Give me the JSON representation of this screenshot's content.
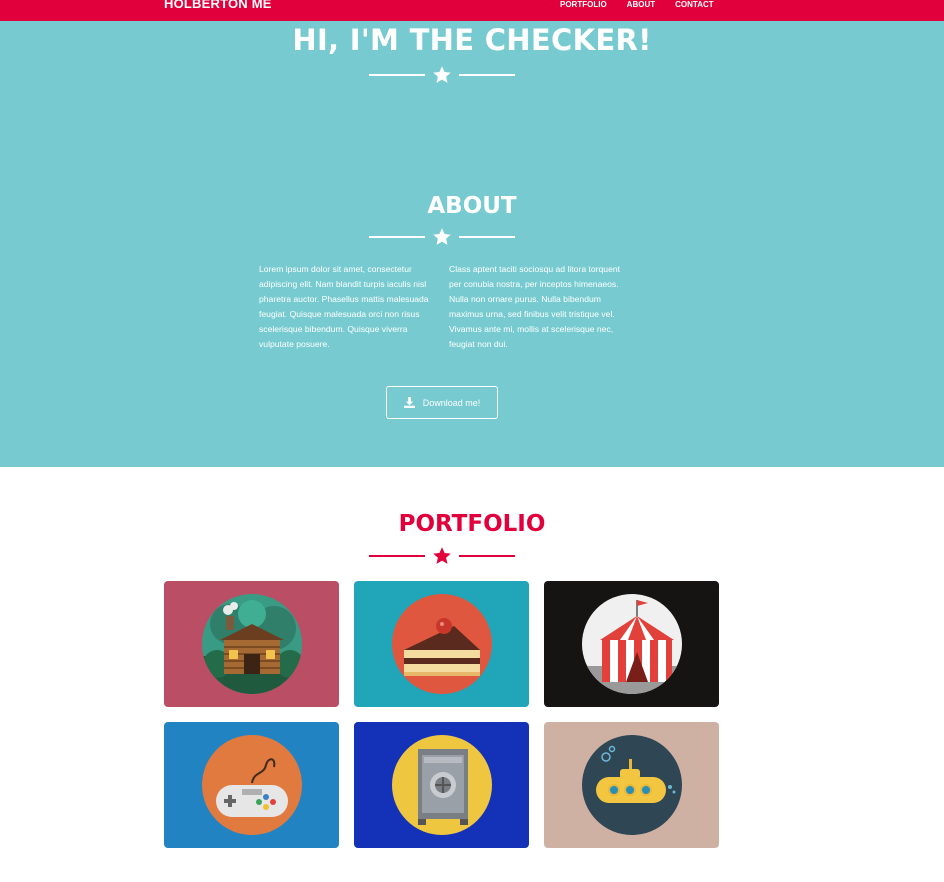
{
  "navbar": {
    "brand": "HOLBERTON ME",
    "links": [
      "PORTFOLIO",
      "ABOUT",
      "CONTACT"
    ],
    "background": "#e2003c"
  },
  "hero": {
    "title": "HI, I'M THE CHECKER!",
    "background": "#77cbd0"
  },
  "about": {
    "title": "ABOUT",
    "left_text": "Lorem ipsum dolor sit amet, consectetur adipiscing elit. Nam blandit turpis iaculis nisl pharetra auctor. Phasellus mattis malesuada feugiat. Quisque malesuada orci non risus scelerisque bibendum. Quisque viverra vulputate posuere.",
    "right_text": "Class aptent taciti sociosqu ad litora torquent per conubia nostra, per inceptos himenaeos. Nulla non ornare purus. Nulla bibendum maximus urna, sed finibus velit tristique vel. Vivamus ante mi, mollis at scelerisque nec, feugiat non dui.",
    "download_label": "Download me!",
    "download_icon": "download-icon"
  },
  "portfolio": {
    "title": "PORTFOLIO",
    "accent": "#e2003c",
    "items": [
      {
        "name": "cabin",
        "bg": "#b94e64"
      },
      {
        "name": "cake",
        "bg": "#21a5b8"
      },
      {
        "name": "circus",
        "bg": "#161413"
      },
      {
        "name": "game-controller",
        "bg": "#2183c2"
      },
      {
        "name": "safe",
        "bg": "#1332b8"
      },
      {
        "name": "submarine",
        "bg": "#cfb1a4"
      }
    ]
  }
}
